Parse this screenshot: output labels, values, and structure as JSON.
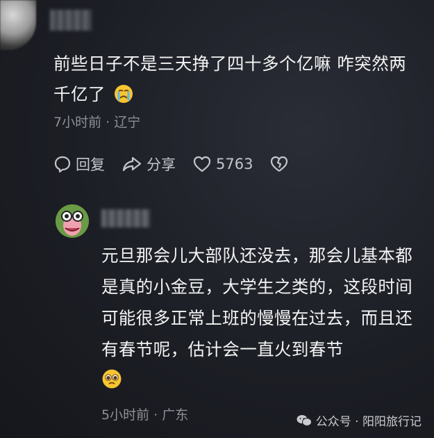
{
  "comment": {
    "text": "前些日子不是三天挣了四十多个亿嘛 咋突然两千亿了",
    "emoji": "crying-face",
    "meta": "7小时前 · 辽宁"
  },
  "actions": {
    "reply_label": "回复",
    "share_label": "分享",
    "like_count": "5763"
  },
  "reply": {
    "text": "元旦那会儿大部队还没去，那会儿基本都是真的小金豆，大学生之类的，这段时间可能很多正常上班的慢慢在过去，而且还有春节呢，估计会一直火到春节",
    "emoji": "pleading-face",
    "meta": "5小时前 · 广东"
  },
  "watermark": {
    "text": "公众号 · 阳阳旅行记",
    "icon": "wechat-icon"
  },
  "colors": {
    "background": "#1c1e25",
    "text": "#f4f4f4",
    "meta": "#8e9097"
  }
}
